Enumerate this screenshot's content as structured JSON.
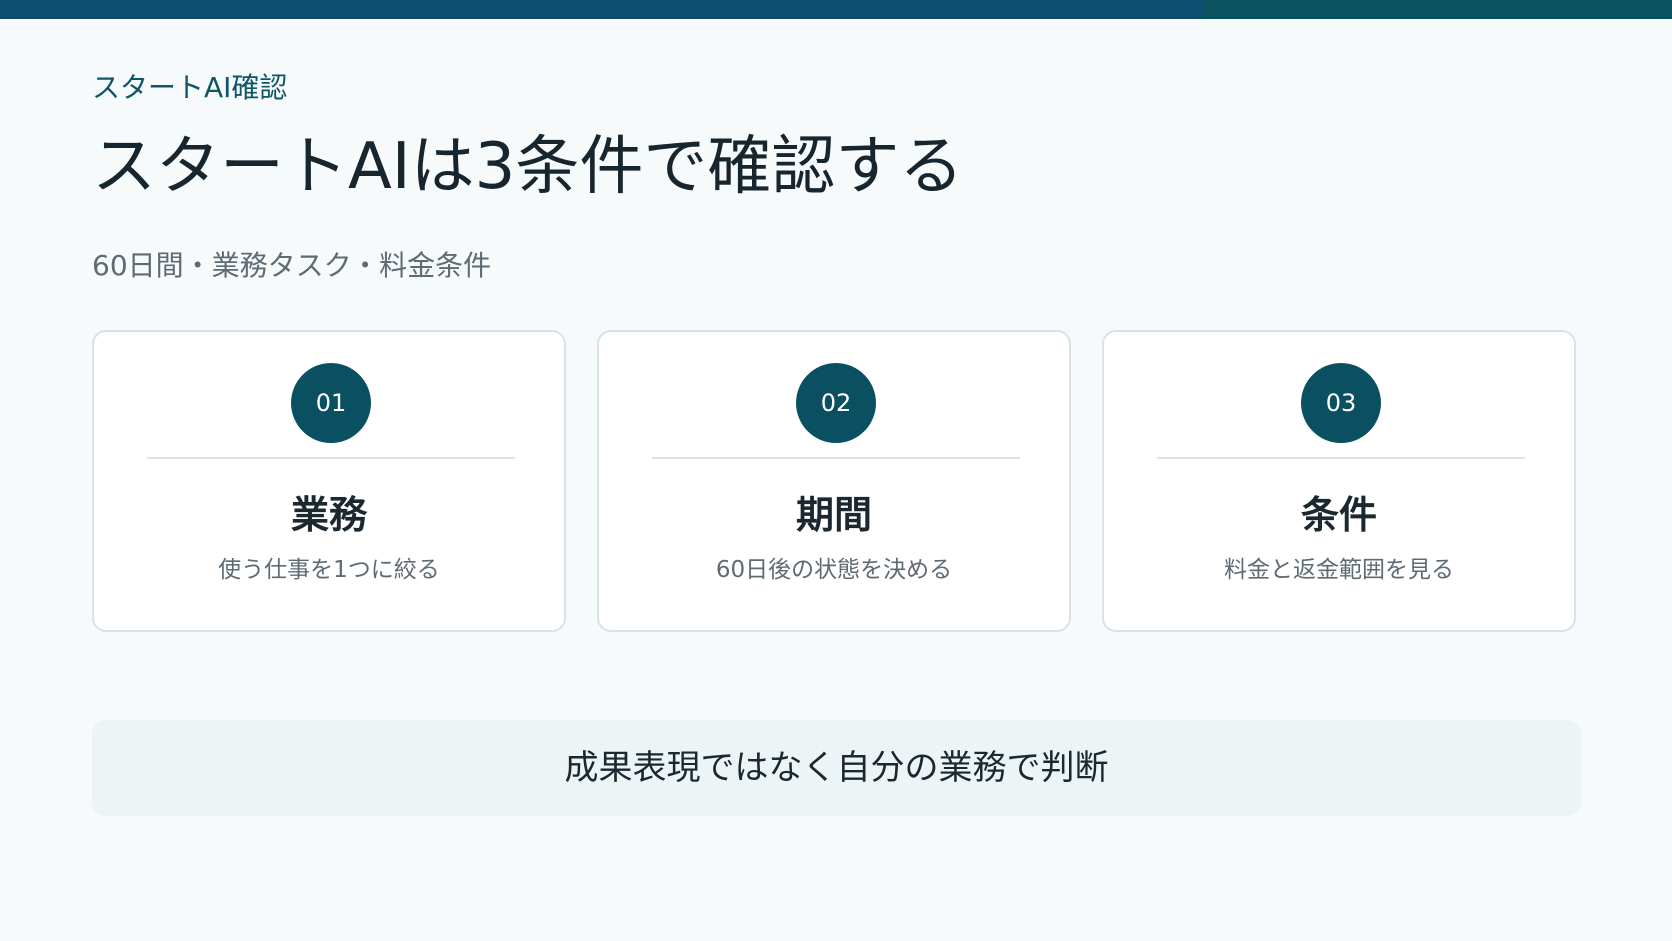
{
  "header": {
    "eyebrow": "スタートAI確認",
    "title": "スタートAIは3条件で確認する",
    "subtitle": "60日間・業務タスク・料金条件"
  },
  "cards": [
    {
      "number": "01",
      "title": "業務",
      "description": "使う仕事を1つに絞る"
    },
    {
      "number": "02",
      "title": "期間",
      "description": "60日後の状態を決める"
    },
    {
      "number": "03",
      "title": "条件",
      "description": "料金と返金範囲を見る"
    }
  ],
  "footer": {
    "note": "成果表現ではなく自分の業務で判断"
  },
  "colors": {
    "accent": "#0b5061",
    "top_bar_primary": "#0f4e73",
    "top_bar_secondary": "#0b5360",
    "background": "#f6fafb",
    "card_border": "#d8e2e7",
    "footer_background": "#edf4f5"
  }
}
